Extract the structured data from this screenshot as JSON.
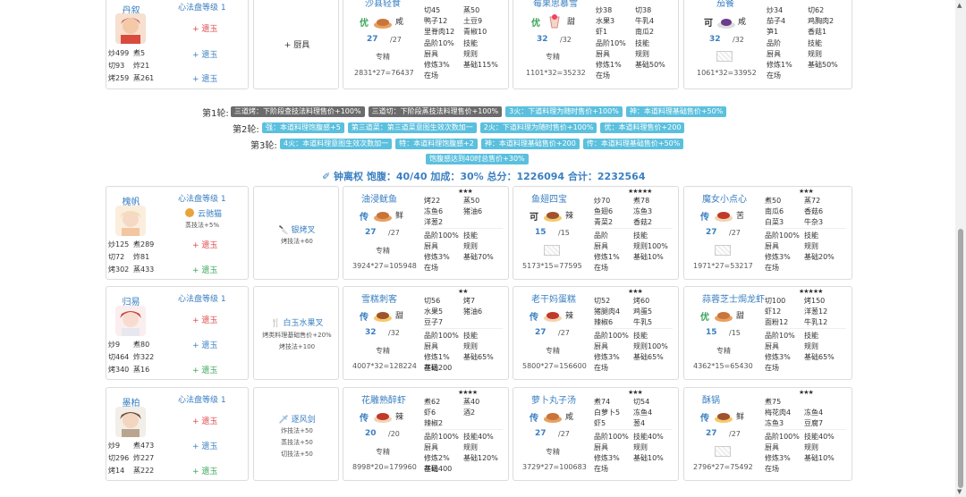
{
  "top_chef": {
    "name": "丹叙",
    "level": "心法盘等级 1",
    "stats": [
      "炒499",
      "煮5",
      "切93",
      "炸21",
      "烤259",
      "蒸261"
    ],
    "gems": [
      "+ 遗玉",
      "+ 遗玉",
      "+ 遗玉"
    ],
    "equip": "+ 厨具"
  },
  "top_recipes": [
    {
      "name": "沙县轻食",
      "grade": "优",
      "flavor": "咸",
      "qty": "27",
      "max": "/27",
      "ingredients": [
        "切45",
        "蒸50",
        "鸭子12",
        "土豆9",
        "里脊肉12",
        "青椒10"
      ],
      "left": [
        "品阶10%",
        "厨具",
        "修炼3%",
        "在场"
      ],
      "right": [
        "技能",
        "规则",
        "基础115%",
        ""
      ],
      "skill": "专精",
      "total": "2831*27=76437"
    },
    {
      "name": "莓果思慕雪",
      "grade": "优",
      "flavor": "甜",
      "qty": "32",
      "max": "/32",
      "ingredients": [
        "炒38",
        "切38",
        "水果3",
        "牛乳4",
        "虾1",
        "南瓜2"
      ],
      "left": [
        "品阶10%",
        "厨具",
        "修炼1%",
        "在场"
      ],
      "right": [
        "技能",
        "规则",
        "基础50%",
        ""
      ],
      "skill": "专精",
      "total": "1101*32=35232"
    },
    {
      "name": "茄餐",
      "grade": "可",
      "flavor": "咸",
      "qty": "32",
      "max": "/32",
      "ingredients": [
        "炒34",
        "切62",
        "茄子4",
        "鸡胸肉2",
        "笋1",
        "香菇1"
      ],
      "left": [
        "品阶",
        "厨具",
        "修炼1%",
        "在场"
      ],
      "right": [
        "技能",
        "规则",
        "基础50%",
        ""
      ],
      "skill": "",
      "total": "1061*32=33952"
    }
  ],
  "rounds": [
    {
      "label": "第1轮:",
      "tags": [
        {
          "text": "三道烤：下阶段查技法料理售价+100%",
          "color": "gray"
        },
        {
          "text": "三道切：下阶段蒸技法料理售价+100%",
          "color": "gray"
        },
        {
          "text": "3火：下道料理为随时售价+100%",
          "color": "blue"
        },
        {
          "text": "神：本道料理基础售价+50%",
          "color": "blue"
        }
      ]
    },
    {
      "label": "第2轮:",
      "tags": [
        {
          "text": "强：本道料理饱腹感+5",
          "color": "blue"
        },
        {
          "text": "第三道菜：第三道菜意图生效次数加一",
          "color": "blue"
        },
        {
          "text": "2火：下道料理为随时售价+100%",
          "color": "blue"
        },
        {
          "text": "优：本道料理售价+200",
          "color": "blue"
        }
      ]
    },
    {
      "label": "第3轮:",
      "tags": [
        {
          "text": "4火：本道料理意图生效次数加一",
          "color": "blue"
        },
        {
          "text": "特：本道料理饱腹感+2",
          "color": "blue"
        },
        {
          "text": "神：本道料理基础售价+200",
          "color": "blue"
        },
        {
          "text": "传：本道料理基础售价+50%",
          "color": "blue"
        }
      ]
    },
    {
      "label": "",
      "tags": [
        {
          "text": "饱腹感达到40时总售价+30%",
          "color": "blue"
        }
      ]
    }
  ],
  "summary": {
    "text": "钟离权 饱腹：40/40 加成：30% 总分：1226094 合计：2232564"
  },
  "chefs": [
    {
      "name": "槐帆",
      "level": "心法盘等级 1",
      "extra": "云驰猫",
      "extra_sub": "蒸技法+5%",
      "stats": [
        "炒125",
        "煮289",
        "切72",
        "炸81",
        "烤302",
        "蒸433"
      ],
      "gems": [
        "+ 遗玉",
        "+ 遗玉"
      ],
      "equip": "银烤叉",
      "equip_effects": [
        "烤技法+60"
      ],
      "recipes": [
        {
          "name": "油浸鱿鱼",
          "stars": "★★★",
          "grade": "传",
          "flavor": "鲜",
          "qty": "27",
          "max": "/27",
          "ingredients": [
            "烤22",
            "蒸50",
            "冻鱼6",
            "猪油6",
            "洋葱2",
            ""
          ],
          "left": [
            "品阶100%",
            "厨具",
            "修炼3%",
            "在场"
          ],
          "right": [
            "技能",
            "规则",
            "基础70%",
            ""
          ],
          "skill": "专精",
          "total": "3924*27=105948"
        },
        {
          "name": "鱼翅四宝",
          "stars": "★★★★★",
          "grade": "可",
          "flavor": "辣",
          "qty": "15",
          "max": "/15",
          "ingredients": [
            "炒70",
            "煮78",
            "鱼翅6",
            "冻鱼3",
            "青菜2",
            "香菇2"
          ],
          "left": [
            "品阶",
            "厨具",
            "修炼1%",
            "在场"
          ],
          "right": [
            "技能",
            "规则100%",
            "基础10%",
            ""
          ],
          "skill": "",
          "total": "5173*15=77595"
        },
        {
          "name": "魔女小点心",
          "stars": "★★★",
          "grade": "传",
          "flavor": "苦",
          "qty": "27",
          "max": "/27",
          "ingredients": [
            "煮50",
            "蒸72",
            "南瓜6",
            "香菇6",
            "白菜3",
            "牛杂3"
          ],
          "left": [
            "品阶100%",
            "厨具",
            "修炼3%",
            "在场"
          ],
          "right": [
            "技能",
            "规则",
            "基础20%",
            ""
          ],
          "skill": "",
          "total": "1971*27=53217"
        }
      ]
    },
    {
      "name": "归易",
      "level": "心法盘等级 1",
      "extra": "",
      "extra_sub": "",
      "stats": [
        "炒9",
        "煮80",
        "切464",
        "炸322",
        "烤340",
        "蒸16"
      ],
      "gems": [
        "+ 遗玉",
        "+ 遗玉",
        "+ 遗玉"
      ],
      "equip": "白玉水果叉",
      "equip_effects": [
        "烤类料理基础售价+20%",
        "烤技法+100"
      ],
      "recipes": [
        {
          "name": "雪糕刺客",
          "stars": "★★",
          "grade": "传",
          "flavor": "甜",
          "qty": "32",
          "max": "/32",
          "ingredients": [
            "切56",
            "烤7",
            "水果5",
            "猪油6",
            "豆子7",
            ""
          ],
          "left": [
            "品阶100%",
            "厨具",
            "修炼1%",
            "在场"
          ],
          "right": [
            "技能",
            "规则",
            "基础65%",
            ""
          ],
          "skill": "专精",
          "total": "4007*32=128224",
          "extra_base": "基础200"
        },
        {
          "name": "老干妈蛋糕",
          "stars": "★★★",
          "grade": "传",
          "flavor": "辣",
          "qty": "27",
          "max": "/27",
          "ingredients": [
            "切52",
            "烤60",
            "猪腿肉4",
            "鸡蛋5",
            "辣椒6",
            "牛乳5"
          ],
          "left": [
            "品阶100%",
            "厨具",
            "修炼3%",
            "在场"
          ],
          "right": [
            "技能",
            "规则100%",
            "基础65%",
            ""
          ],
          "skill": "专精",
          "total": "5800*27=156600"
        },
        {
          "name": "蒜蓉芝士焗龙虾",
          "stars": "★★★★★",
          "grade": "优",
          "flavor": "甜",
          "qty": "15",
          "max": "/15",
          "ingredients": [
            "切100",
            "烤150",
            "虾12",
            "洋葱12",
            "面粉12",
            "牛乳12"
          ],
          "left": [
            "品阶10%",
            "厨具",
            "修炼3%",
            "在场"
          ],
          "right": [
            "技能",
            "规则",
            "基础65%",
            ""
          ],
          "skill": "专精",
          "total": "4362*15=65430"
        }
      ]
    },
    {
      "name": "墨柏",
      "level": "心法盘等级 1",
      "extra": "",
      "extra_sub": "",
      "stats": [
        "炒9",
        "煮473",
        "切296",
        "炸227",
        "烤14",
        "蒸222"
      ],
      "gems": [
        "+ 遗玉",
        "+ 遗玉",
        "+ 遗玉"
      ],
      "equip": "逐风剑",
      "equip_effects": [
        "炸技法+50",
        "蒸技法+50",
        "切技法+50"
      ],
      "recipes": [
        {
          "name": "花雕熟醉虾",
          "stars": "★★★★",
          "grade": "传",
          "flavor": "辣",
          "qty": "20",
          "max": "/20",
          "ingredients": [
            "煮62",
            "蒸40",
            "虾6",
            "酒2",
            "辣椒2",
            ""
          ],
          "left": [
            "品阶100%",
            "厨具",
            "修炼2%",
            "在场"
          ],
          "right": [
            "技能40%",
            "规则",
            "基础120%",
            ""
          ],
          "skill": "专精",
          "total": "8998*20=179960",
          "extra_base": "基础400"
        },
        {
          "name": "萝卜丸子汤",
          "stars": "★★★",
          "grade": "传",
          "flavor": "咸",
          "qty": "27",
          "max": "/27",
          "ingredients": [
            "煮74",
            "切54",
            "白萝卜5",
            "冻鱼4",
            "虾5",
            "葱4"
          ],
          "left": [
            "品阶100%",
            "厨具",
            "修炼3%",
            "在场"
          ],
          "right": [
            "技能40%",
            "规则",
            "基础10%",
            ""
          ],
          "skill": "专精",
          "total": "3729*27=100683"
        },
        {
          "name": "酥锅",
          "stars": "★★★",
          "grade": "传",
          "flavor": "鲜",
          "qty": "27",
          "max": "/27",
          "ingredients": [
            "煮75",
            "",
            "梅花肉4",
            "冻鱼4",
            "冻鱼3",
            "豆腐7"
          ],
          "left": [
            "品阶100%",
            "厨具",
            "修炼3%",
            "在场"
          ],
          "right": [
            "技能40%",
            "规则",
            "基础10%",
            ""
          ],
          "skill": "",
          "total": "2796*27=75492"
        }
      ]
    }
  ],
  "colors": {
    "accent": "#3a7fc1",
    "tag_blue": "#5bc0de",
    "tag_gray": "#6b6b6b",
    "gem_red": "#e0474c",
    "gem_green": "#3aa55a"
  }
}
